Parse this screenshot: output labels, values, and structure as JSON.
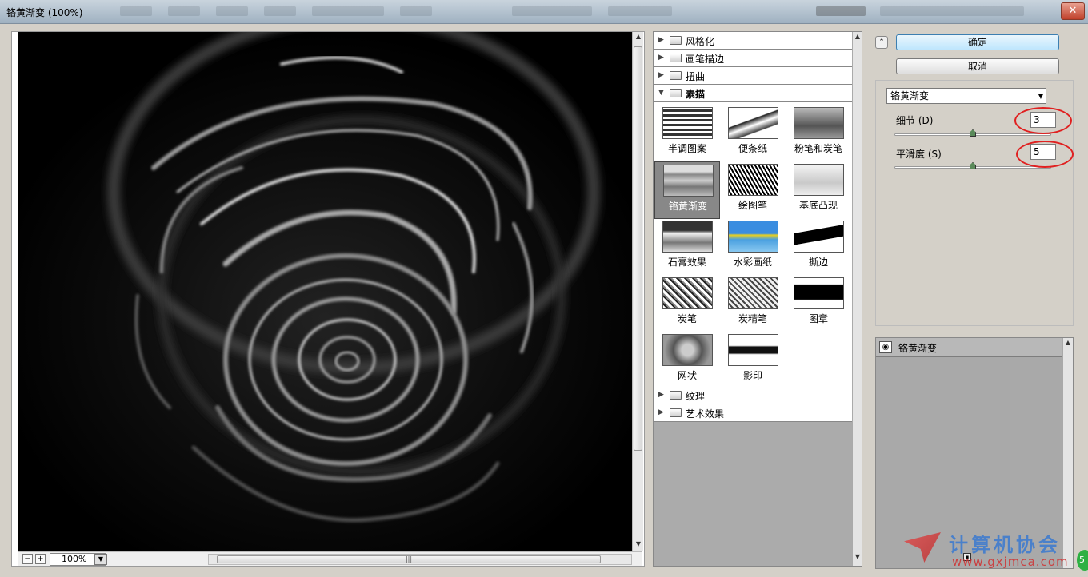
{
  "window": {
    "title": "铬黄渐变 (100%)",
    "close_glyph": "✕"
  },
  "preview": {
    "zoom": "100%",
    "minus": "−",
    "plus": "+"
  },
  "buttons": {
    "ok": "确定",
    "cancel": "取消"
  },
  "filter": {
    "selected": "铬黄渐变",
    "params": [
      {
        "label": "细节 (D)",
        "value": "3",
        "level": 0.5
      },
      {
        "label": "平滑度 (S)",
        "value": "5",
        "level": 0.5
      }
    ]
  },
  "gallery": {
    "categories_top": [
      "风格化",
      "画笔描边",
      "扭曲",
      "素描"
    ],
    "categories_bottom": [
      "纹理",
      "艺术效果"
    ],
    "thumbnails": [
      "半调图案",
      "便条纸",
      "粉笔和炭笔",
      "铬黄渐变",
      "绘图笔",
      "基底凸现",
      "石膏效果",
      "水彩画纸",
      "撕边",
      "炭笔",
      "炭精笔",
      "图章",
      "网状",
      "影印"
    ],
    "selected_index": 3
  },
  "layers": {
    "items": [
      "铬黄渐变"
    ]
  },
  "watermark": {
    "text": "计算机协会",
    "url": "www.gxjmca.com"
  },
  "colors": {
    "annotation": "#e02020",
    "ok_border": "#3c7fb1"
  },
  "icons": {
    "folder": "folder-icon",
    "eye": "eye-icon",
    "collapse": "collapse-icon"
  }
}
